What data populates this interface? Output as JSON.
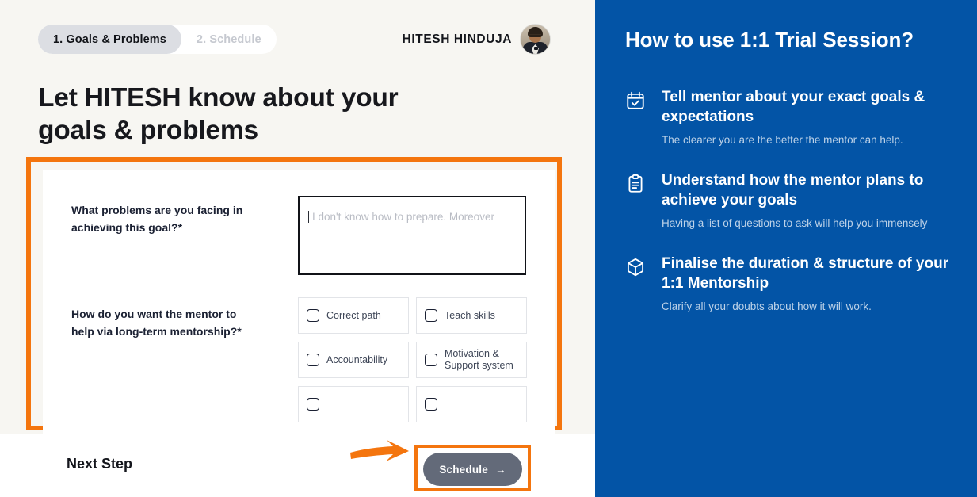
{
  "tabs": [
    {
      "label": "1. Goals & Problems",
      "active": true
    },
    {
      "label": "2. Schedule",
      "active": false
    }
  ],
  "user": {
    "name": "HITESH HINDUJA"
  },
  "heading": "Let HITESH know about your goals & problems",
  "form": {
    "question1": {
      "label": "What problems are you facing in achieving this goal?*",
      "placeholder": "I don't know how to prepare. Moreover"
    },
    "question2": {
      "label": "How do you want the mentor to help via long-term mentorship?*",
      "options": [
        "Correct path",
        "Teach skills",
        "Accountability",
        "Motivation & Support system"
      ]
    }
  },
  "footer": {
    "next_step_label": "Next Step",
    "schedule_button": "Schedule",
    "schedule_arrow": "→"
  },
  "panel": {
    "title": "How to use 1:1 Trial Session?",
    "tips": [
      {
        "icon": "calendar-check-icon",
        "title": "Tell mentor about your exact goals & expectations",
        "desc": "The clearer you are the better the mentor can help."
      },
      {
        "icon": "clipboard-icon",
        "title": "Understand how the mentor plans to achieve your goals",
        "desc": "Having a list of questions to ask will help you immensely"
      },
      {
        "icon": "cube-icon",
        "title": "Finalise the duration & structure of your 1:1 Mentorship",
        "desc": "Clarify all your doubts about how it will work."
      }
    ]
  },
  "colors": {
    "accent_orange": "#f4750e",
    "panel_blue": "#0354a6",
    "button_grey": "#636a79",
    "page_bg": "#f7f6f2"
  }
}
